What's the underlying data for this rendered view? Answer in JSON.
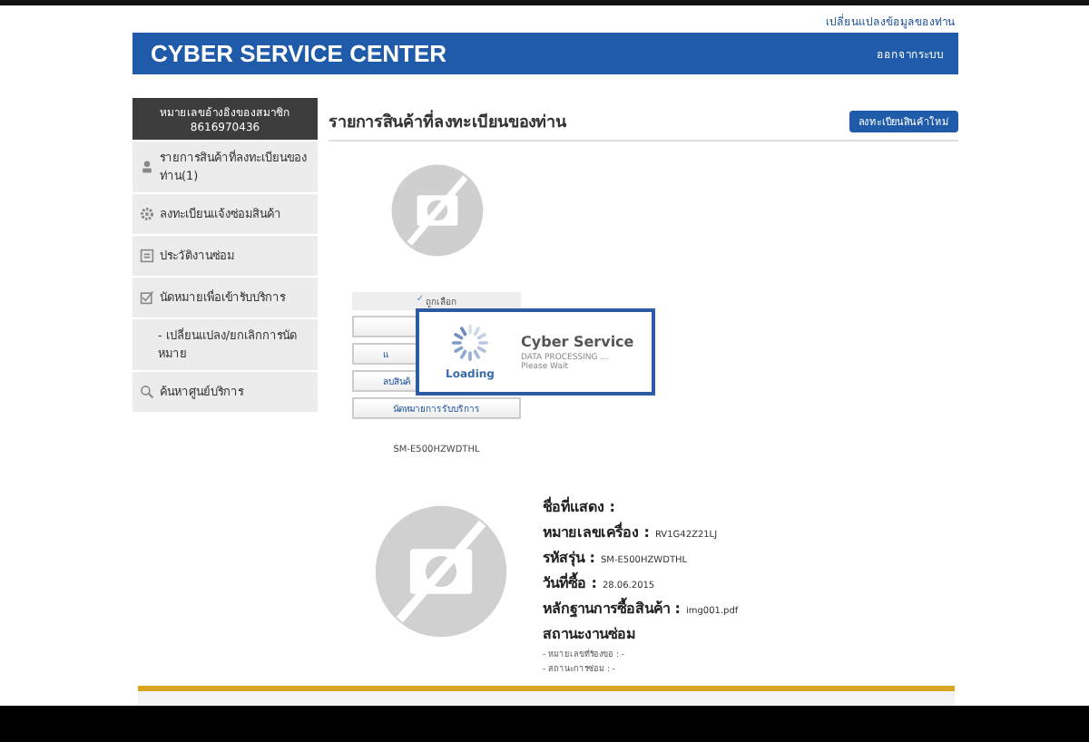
{
  "top_link": "เปลี่ยนแปลงข้อมูลของท่าน",
  "header": {
    "title": "CYBER SERVICE CENTER",
    "logout": "ออกจากระบบ"
  },
  "sidebar": {
    "member_label": "หมายเลขอ้างอิงของสมาชิก",
    "member_id": "8616970436",
    "items": [
      {
        "kind": "products",
        "label": "รายการสินค้าที่ลงทะเบียนของท่าน(1)"
      },
      {
        "kind": "repair",
        "label": "ลงทะเบียนแจ้งซ่อมสินค้า"
      },
      {
        "kind": "history",
        "label": "ประวัติงานซ่อม"
      },
      {
        "kind": "appointment",
        "label": "นัดหมายเพื่อเข้ารับบริการ"
      },
      {
        "kind": "sub",
        "label": "- เปลี่ยนแปลง/ยกเลิกการนัดหมาย"
      },
      {
        "kind": "search",
        "label": "ค้นหาศูนย์บริการ"
      }
    ]
  },
  "main": {
    "title": "รายการสินค้าที่ลงทะเบียนของท่าน",
    "new_button": "ลงทะเบียนสินค้าใหม่"
  },
  "product": {
    "selected_mark": "✓",
    "selected_label": "ถูกเลือก",
    "actions": [
      {
        "kind": "covered"
      },
      {
        "kind": "labeled",
        "label": "แ"
      },
      {
        "kind": "labeled",
        "label": "ลบสินค้"
      },
      {
        "kind": "labeled",
        "label": "นัดหมายการรับบริการ"
      }
    ],
    "model": "SM-E500HZWDTHL"
  },
  "loading": {
    "spinner_label": "Loading",
    "title": "Cyber Service",
    "line_1": "DATA PROCESSING ...",
    "line_2": "Please Wait"
  },
  "details": {
    "fields": [
      {
        "label": "ชื่อที่แสดง :"
      },
      {
        "label": "หมายเลขเครื่อง :",
        "value": "RV1G42Z21LJ"
      },
      {
        "label": "รหัสรุ่น :",
        "value": "SM-E500HZWDTHL"
      },
      {
        "label": "วันที่ซื้อ :",
        "value": "28.06.2015"
      },
      {
        "label": "หลักฐานการซื้อสินค้า :",
        "value": "img001.pdf"
      }
    ],
    "status_title": "สถานะงานซ่อม",
    "status_lines": [
      "- หมายเลขที่ร้องขอ : -",
      "- สถานะการซ่อม : -"
    ]
  }
}
